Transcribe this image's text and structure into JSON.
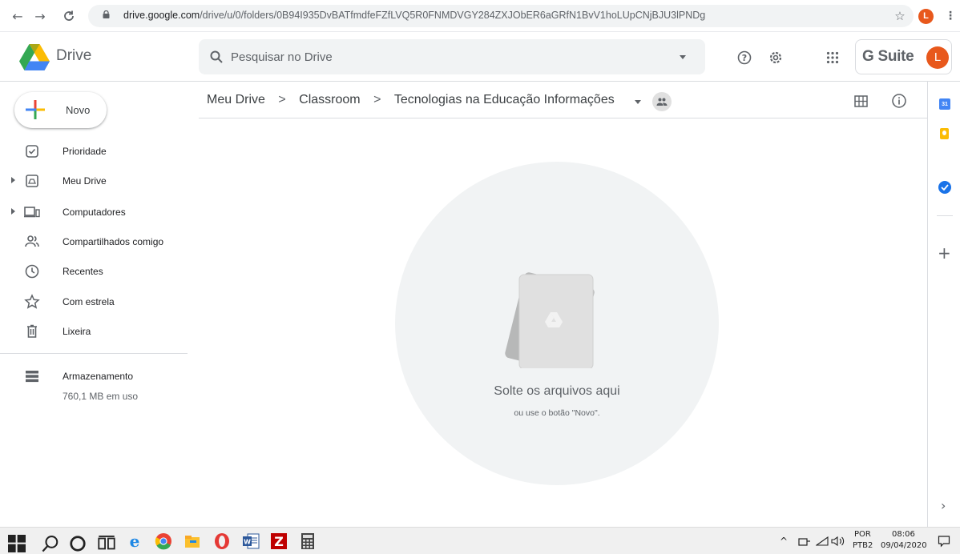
{
  "browser": {
    "url_host": "drive.google.com",
    "url_path": "/drive/u/0/folders/0B94I935DvBATfmdfeFZfLVQ5R0FNMDVGY284ZXJObER6aGRfN1BvV1hoLUpCNjBJU3lPNDg",
    "profile_initial": "L"
  },
  "header": {
    "app_name": "Drive",
    "search_placeholder": "Pesquisar no Drive",
    "gsuite_label": "G Suite",
    "account_initial": "L"
  },
  "sidebar": {
    "new_label": "Novo",
    "items": [
      {
        "label": "Prioridade",
        "icon": "priority-icon"
      },
      {
        "label": "Meu Drive",
        "icon": "my-drive-icon"
      },
      {
        "label": "Computadores",
        "icon": "computers-icon"
      },
      {
        "label": "Compartilhados comigo",
        "icon": "shared-icon"
      },
      {
        "label": "Recentes",
        "icon": "clock-icon"
      },
      {
        "label": "Com estrela",
        "icon": "star-icon"
      },
      {
        "label": "Lixeira",
        "icon": "trash-icon"
      }
    ],
    "storage_label": "Armazenamento",
    "storage_used": "760,1 MB em uso"
  },
  "breadcrumb": {
    "items": [
      "Meu Drive",
      "Classroom",
      "Tecnologias na Educação Informações"
    ],
    "separator": ">"
  },
  "empty_state": {
    "title": "Solte os arquivos aqui",
    "subtitle": "ou use o botão \"Novo\"."
  },
  "taskbar": {
    "lang_top": "POR",
    "lang_bottom": "PTB2",
    "time": "08:06",
    "date": "09/04/2020"
  },
  "colors": {
    "google_blue": "#4285f4",
    "google_red": "#ea4335",
    "google_yellow": "#fbbc04",
    "google_green": "#34a853",
    "avatar_orange": "#e8581c"
  }
}
